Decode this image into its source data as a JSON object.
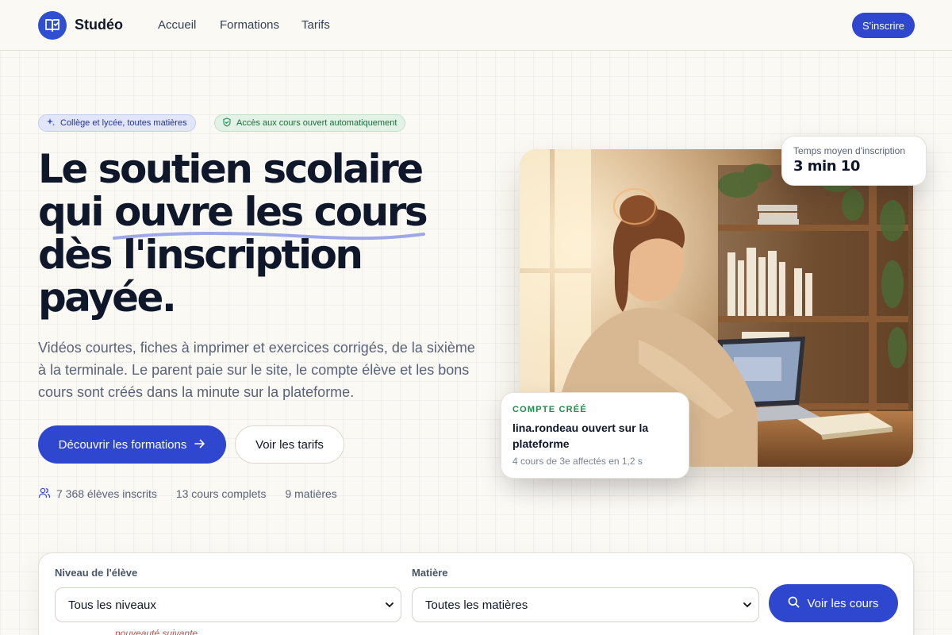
{
  "header": {
    "brand": "Studéo",
    "nav": [
      "Accueil",
      "Formations",
      "Tarifs"
    ],
    "cta": "S'inscrire"
  },
  "hero": {
    "badges": [
      "Collège et lycée, toutes matières",
      "Accès aux cours ouvert automatiquement"
    ],
    "headline": {
      "line1": "Le soutien scolaire",
      "line2_pre": "qui ",
      "line2_highlight": "ouvre les cours",
      "line3": "dès l'inscription",
      "line4": "payée."
    },
    "lead": "Vidéos courtes, fiches à imprimer et exercices corrigés, de la sixième à la terminale. Le parent paie sur le site, le compte élève et les bons cours sont créés dans la minute sur la plateforme.",
    "primary_button": "Découvrir les formations",
    "secondary_button": "Voir les tarifs",
    "stats": [
      "7 368 élèves inscrits",
      "13 cours complets",
      "9 matières"
    ]
  },
  "time_card": {
    "label": "Temps moyen d'inscription",
    "value": "3 min 10"
  },
  "account_card": {
    "kicker": "COMPTE CRÉÉ",
    "title": "lina.rondeau ouvert sur la plateforme",
    "subtitle": "4 cours de 3e affectés en 1,2 s"
  },
  "search": {
    "level_label": "Niveau de l'élève",
    "level_value": "Tous les niveaux",
    "subject_label": "Matière",
    "subject_value": "Toutes les matières",
    "button": "Voir les cours",
    "note": "nouveauté suivante"
  },
  "colors": {
    "primary": "#2f46cf",
    "badge_blue_bg": "#e2e6fb",
    "badge_green_bg": "#e2f2e6",
    "success": "#238a4e",
    "page_bg": "#fbf9f4"
  },
  "icons": [
    "book-check-icon",
    "sparkle-icon",
    "shield-check-icon",
    "arrow-right-icon",
    "users-icon",
    "search-icon",
    "chevron-down-icon"
  ]
}
